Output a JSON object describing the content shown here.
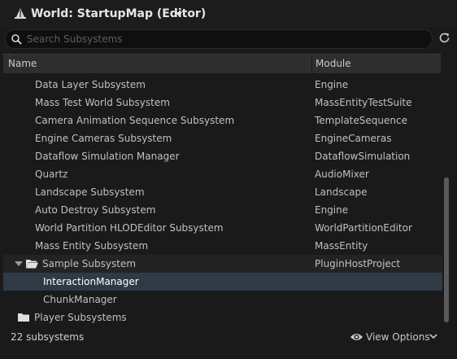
{
  "header": {
    "title": "World: StartupMap (Editor)"
  },
  "search": {
    "placeholder": "Search Subsystems",
    "value": ""
  },
  "columns": {
    "name": "Name",
    "module": "Module"
  },
  "rows": [
    {
      "name": "Data Layer Subsystem",
      "module": "Engine"
    },
    {
      "name": "Mass Test World Subsystem",
      "module": "MassEntityTestSuite"
    },
    {
      "name": "Camera Animation Sequence Subsystem",
      "module": "TemplateSequence"
    },
    {
      "name": "Engine Cameras Subsystem",
      "module": "EngineCameras"
    },
    {
      "name": "Dataflow Simulation Manager",
      "module": "DataflowSimulation"
    },
    {
      "name": "Quartz",
      "module": "AudioMixer"
    },
    {
      "name": "Landscape Subsystem",
      "module": "Landscape"
    },
    {
      "name": "Auto Destroy Subsystem",
      "module": "Engine"
    },
    {
      "name": "World Partition HLODEditor Subsystem",
      "module": "WorldPartitionEditor"
    },
    {
      "name": "Mass Entity Subsystem",
      "module": "MassEntity"
    }
  ],
  "group": {
    "name": "Sample Subsystem",
    "module": "PluginHostProject"
  },
  "group_children": [
    {
      "name": "InteractionManager",
      "module": ""
    },
    {
      "name": "ChunkManager",
      "module": ""
    }
  ],
  "player_group": {
    "name": "Player Subsystems"
  },
  "footer": {
    "count": "22 subsystems",
    "view_options": "View Options"
  },
  "colors": {
    "selected": "#2f3a47",
    "background": "#1a1a1a"
  }
}
